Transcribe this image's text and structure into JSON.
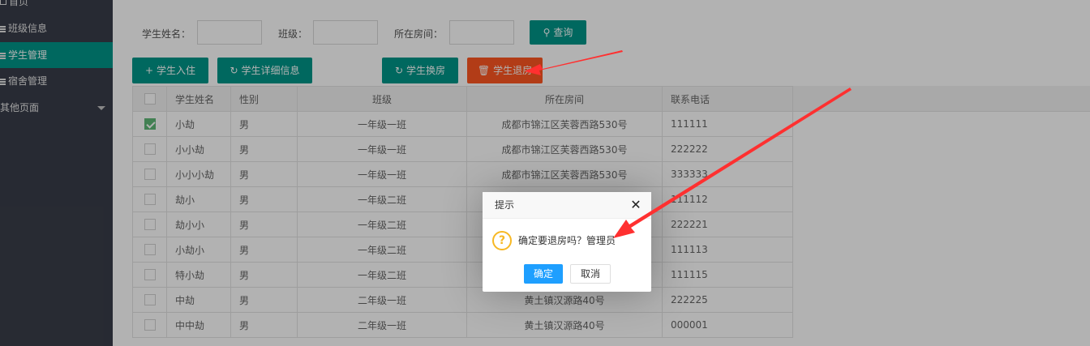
{
  "sidebar": {
    "home": "首页",
    "items": [
      {
        "label": "班级信息",
        "active": false
      },
      {
        "label": "学生管理",
        "active": true
      },
      {
        "label": "宿舍管理",
        "active": false
      },
      {
        "label": "其他页面",
        "active": false
      }
    ]
  },
  "search": {
    "name_label": "学生姓名：",
    "class_label": "班级：",
    "room_label": "所在房间：",
    "query_label": "查询"
  },
  "toolbar": {
    "checkin_label": "学生入住",
    "detail_label": "学生详细信息",
    "swap_label": "学生换房",
    "checkout_label": "学生退房"
  },
  "table": {
    "columns": [
      "学生姓名",
      "性别",
      "班级",
      "所在房间",
      "联系电话"
    ],
    "rows": [
      {
        "checked": true,
        "name": "小劫",
        "gender": "男",
        "class": "一年级一班",
        "room": "成都市锦江区芙蓉西路530号",
        "phone": "111111"
      },
      {
        "checked": false,
        "name": "小小劫",
        "gender": "男",
        "class": "一年级一班",
        "room": "成都市锦江区芙蓉西路530号",
        "phone": "222222"
      },
      {
        "checked": false,
        "name": "小小小劫",
        "gender": "男",
        "class": "一年级一班",
        "room": "成都市锦江区芙蓉西路530号",
        "phone": "333333"
      },
      {
        "checked": false,
        "name": "劫小",
        "gender": "男",
        "class": "一年级二班",
        "room": "",
        "phone": "111112"
      },
      {
        "checked": false,
        "name": "劫小小",
        "gender": "男",
        "class": "一年级二班",
        "room": "",
        "phone": "222221"
      },
      {
        "checked": false,
        "name": "小劫小",
        "gender": "男",
        "class": "一年级二班",
        "room": "",
        "phone": "111113"
      },
      {
        "checked": false,
        "name": "特小劫",
        "gender": "男",
        "class": "一年级二班",
        "room": "",
        "phone": "111115"
      },
      {
        "checked": false,
        "name": "中劫",
        "gender": "男",
        "class": "二年级一班",
        "room": "黄土镇汉源路40号",
        "phone": "222225"
      },
      {
        "checked": false,
        "name": "中中劫",
        "gender": "男",
        "class": "二年级一班",
        "room": "黄土镇汉源路40号",
        "phone": "000001"
      }
    ]
  },
  "dialog": {
    "title": "提示",
    "close_glyph": "✕",
    "icon_glyph": "?",
    "message": "确定要退房吗？管理员",
    "ok_label": "确定",
    "cancel_label": "取消"
  },
  "colors": {
    "sidebar_bg": "#393d49",
    "accent_teal": "#009688",
    "danger_orange": "#ff5722",
    "dialog_ok_blue": "#1e9fff",
    "annotation_red": "#ff3030"
  }
}
